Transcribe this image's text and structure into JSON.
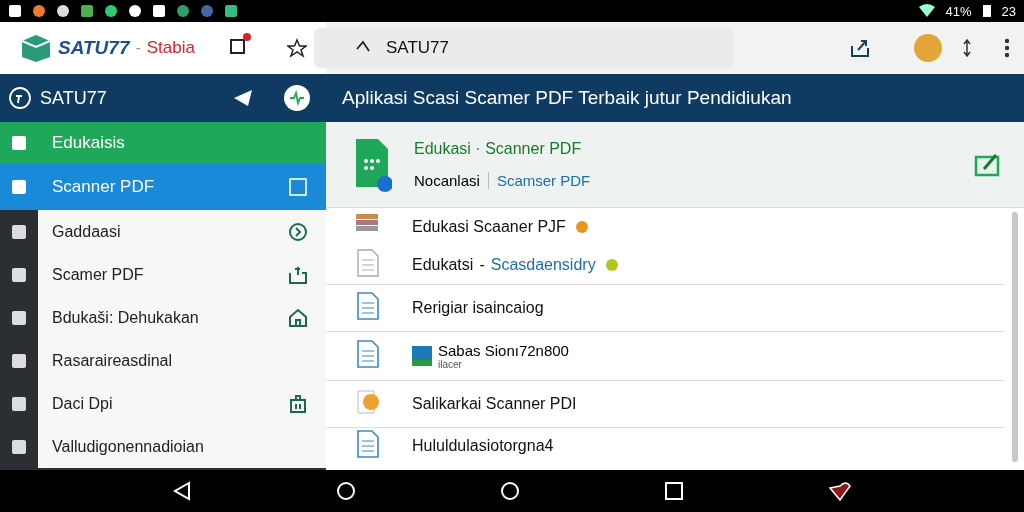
{
  "status_bar": {
    "battery": "41%",
    "time": "23"
  },
  "app_bar": {
    "brand": "SATU77",
    "separator": "-",
    "subtitle": "Stabia",
    "notification_badge": true,
    "search": {
      "value": "SATU77"
    }
  },
  "header": {
    "account": "SATU77",
    "title": "Aplikasi Scasi Scamer PDF Terbaik jutur Pendidiukan"
  },
  "sidebar": {
    "items": [
      {
        "label": "Edukaisis",
        "kind": "header",
        "selected": false
      },
      {
        "label": "Scanner PDF",
        "kind": "item",
        "selected": true
      },
      {
        "label": "Gaddaasi",
        "kind": "item",
        "selected": false
      },
      {
        "label": "Scamer PDF",
        "kind": "item",
        "selected": false
      },
      {
        "label": "Bdukaši: Dehukakan",
        "kind": "item",
        "selected": false
      },
      {
        "label": "Rasaraireasdinal",
        "kind": "item",
        "selected": false
      },
      {
        "label": "Daci Dpi",
        "kind": "item",
        "selected": false
      },
      {
        "label": "Valludigonennadioian",
        "kind": "item",
        "selected": false
      }
    ]
  },
  "document_card": {
    "title": "Edukasi · Scanner PDF",
    "meta": "Nocanlasi",
    "link": "Scamser PDF"
  },
  "files": [
    {
      "kind": "stack",
      "name": "Edukasi Scaaner PJF",
      "color": "#e8961c"
    },
    {
      "kind": "doc",
      "name": "Edukatsi",
      "separator": "-",
      "link": "Scasdaensidry",
      "color": "#b5c41e"
    },
    {
      "kind": "doc-blue",
      "name": "Rerigiar isaincaiog"
    },
    {
      "kind": "doc-blue",
      "name": "Sabas Sionı72n800",
      "subtitle": "ilacer"
    },
    {
      "kind": "image",
      "name": "Salikarkai Scanner PDI"
    },
    {
      "kind": "doc-blue",
      "name": "Hululdulasiotorgna4"
    }
  ]
}
